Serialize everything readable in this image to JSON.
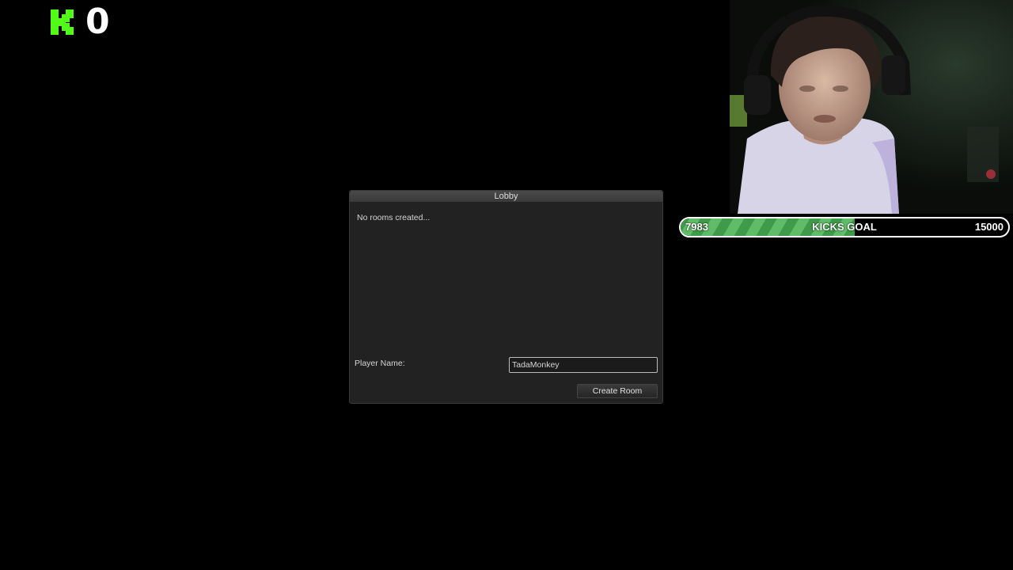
{
  "overlay": {
    "kick_count": "0",
    "logo_color": "#53fc18"
  },
  "goal": {
    "current": "7983",
    "label": "KICKS GOAL",
    "target": "15000",
    "progress_fraction": 0.532,
    "fill_colors": [
      "#3f9a49",
      "#5fbd67"
    ]
  },
  "lobby": {
    "title": "Lobby",
    "rooms_text": "No rooms created...",
    "player_name_label": "Player Name:",
    "player_name_value": "TadaMonkey",
    "create_room_label": "Create Room"
  }
}
